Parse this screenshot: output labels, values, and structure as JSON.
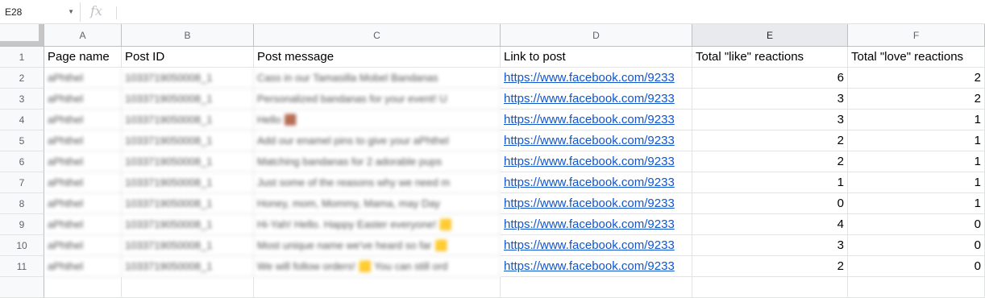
{
  "name_box": {
    "value": "E28"
  },
  "formula_bar": {
    "fx_label": "fx",
    "content": ""
  },
  "columns": [
    "A",
    "B",
    "C",
    "D",
    "E",
    "F"
  ],
  "row_numbers": [
    "1",
    "2",
    "3",
    "4",
    "5",
    "6",
    "7",
    "8",
    "9",
    "10",
    "11"
  ],
  "headers": [
    "Page name",
    "Post ID",
    "Post message",
    "Link to post",
    "Total \"like\" reactions",
    "Total \"love\" reactions"
  ],
  "rows": [
    {
      "page": "aPhthel",
      "post_id": "1033719050008_1",
      "message": "Cass in our Tamasilla Mobel Bandanas",
      "link": "https://www.facebook.com/9233",
      "likes": "6",
      "loves": "2"
    },
    {
      "page": "aPhthel",
      "post_id": "1033719050008_1",
      "message": "Personalized bandanas for your event! U",
      "link": "https://www.facebook.com/9233",
      "likes": "3",
      "loves": "2"
    },
    {
      "page": "aPhthel",
      "post_id": "1033719050008_1",
      "message": "Hello 🟫",
      "link": "https://www.facebook.com/9233",
      "likes": "3",
      "loves": "1"
    },
    {
      "page": "aPhthel",
      "post_id": "1033719050008_1",
      "message": "Add our enamel pins to give your aPhthel",
      "link": "https://www.facebook.com/9233",
      "likes": "2",
      "loves": "1"
    },
    {
      "page": "aPhthel",
      "post_id": "1033719050008_1",
      "message": "Matching bandanas for 2 adorable pups",
      "link": "https://www.facebook.com/9233",
      "likes": "2",
      "loves": "1"
    },
    {
      "page": "aPhthel",
      "post_id": "1033719050008_1",
      "message": "Just some of the reasons why we need m",
      "link": "https://www.facebook.com/9233",
      "likes": "1",
      "loves": "1"
    },
    {
      "page": "aPhthel",
      "post_id": "1033719050008_1",
      "message": "Honey, mom, Mommy, Mama, may Day",
      "link": "https://www.facebook.com/9233",
      "likes": "0",
      "loves": "1"
    },
    {
      "page": "aPhthel",
      "post_id": "1033719050008_1",
      "message": "Hi-Yah! Hello. Happy Easter everyone! 🟨",
      "link": "https://www.facebook.com/9233",
      "likes": "4",
      "loves": "0"
    },
    {
      "page": "aPhthel",
      "post_id": "1033719050008_1",
      "message": "Most unique name we've heard so far 🟨",
      "link": "https://www.facebook.com/9233",
      "likes": "3",
      "loves": "0"
    },
    {
      "page": "aPhthel",
      "post_id": "1033719050008_1",
      "message": "We will follow orders! 🟨 You can still ord",
      "link": "https://www.facebook.com/9233",
      "likes": "2",
      "loves": "0"
    }
  ]
}
